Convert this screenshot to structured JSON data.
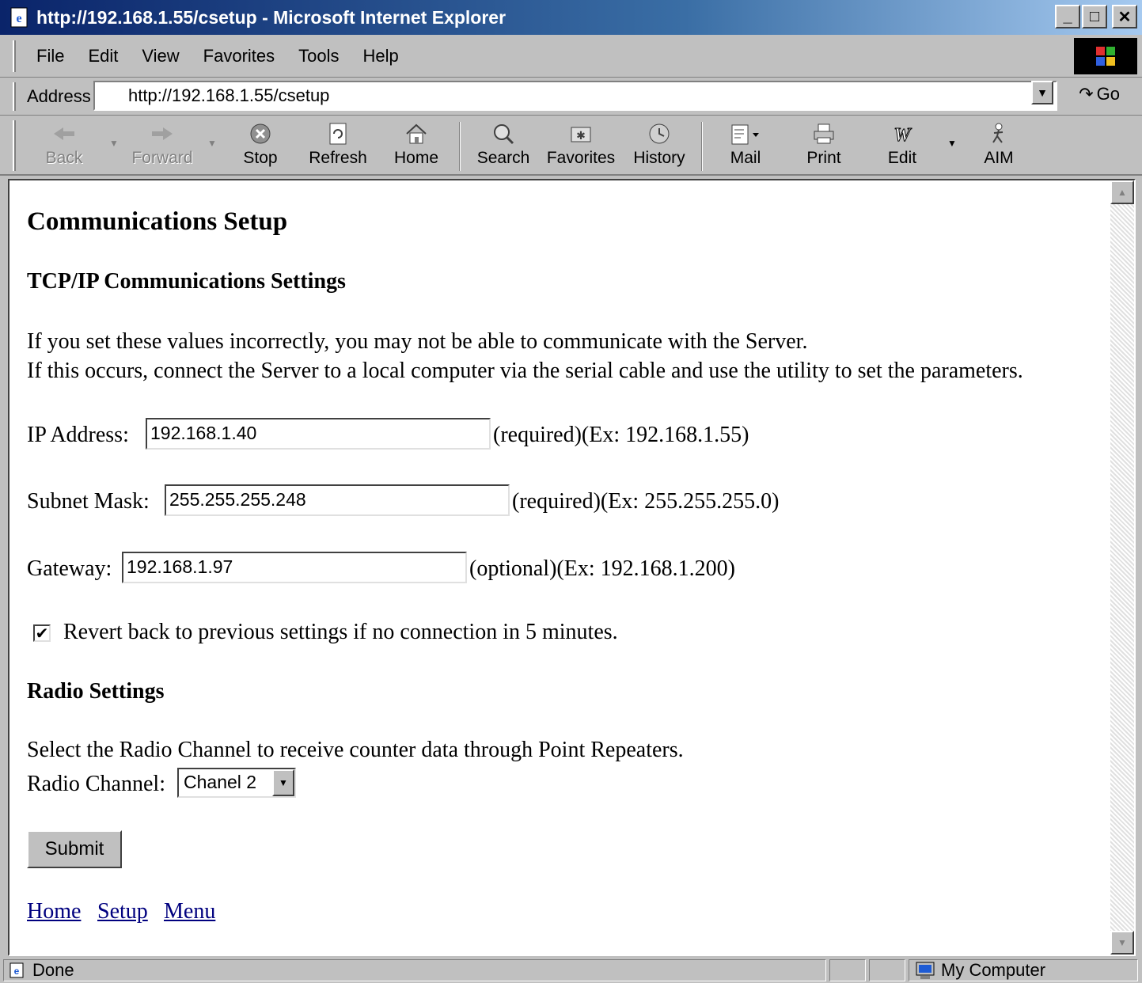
{
  "window": {
    "title": "http://192.168.1.55/csetup - Microsoft Internet Explorer"
  },
  "menu": {
    "items": [
      "File",
      "Edit",
      "View",
      "Favorites",
      "Tools",
      "Help"
    ]
  },
  "address": {
    "label": "Address",
    "url": "http://192.168.1.55/csetup",
    "go_label": "Go"
  },
  "toolbar": {
    "back": "Back",
    "forward": "Forward",
    "stop": "Stop",
    "refresh": "Refresh",
    "home": "Home",
    "search": "Search",
    "favorites": "Favorites",
    "history": "History",
    "mail": "Mail",
    "print": "Print",
    "edit": "Edit",
    "aim": "AIM"
  },
  "page": {
    "title": "Communications Setup",
    "tcp_heading": "TCP/IP Communications Settings",
    "warning_line1": "If you set these values incorrectly, you may not be able to communicate with the Server.",
    "warning_line2": "If this occurs, connect the Server to a local computer via the serial cable and use the utility to set the parameters.",
    "ip": {
      "label": "IP Address:",
      "value": "192.168.1.40",
      "hint": "(required)(Ex: 192.168.1.55)"
    },
    "subnet": {
      "label": "Subnet Mask:",
      "value": "255.255.255.248",
      "hint": "(required)(Ex: 255.255.255.0)"
    },
    "gateway": {
      "label": "Gateway:",
      "value": "192.168.1.97",
      "hint": "(optional)(Ex: 192.168.1.200)"
    },
    "revert": {
      "checked": true,
      "label": "Revert back to previous settings if no connection in 5 minutes."
    },
    "radio_heading": "Radio Settings",
    "radio_text": "Select the Radio Channel to receive counter data through Point Repeaters.",
    "radio_channel_label": "Radio Channel:",
    "radio_channel_value": "Chanel 2",
    "submit_label": "Submit",
    "links": [
      "Home",
      "Setup",
      "Menu"
    ]
  },
  "status": {
    "text": "Done",
    "zone": "My Computer"
  }
}
